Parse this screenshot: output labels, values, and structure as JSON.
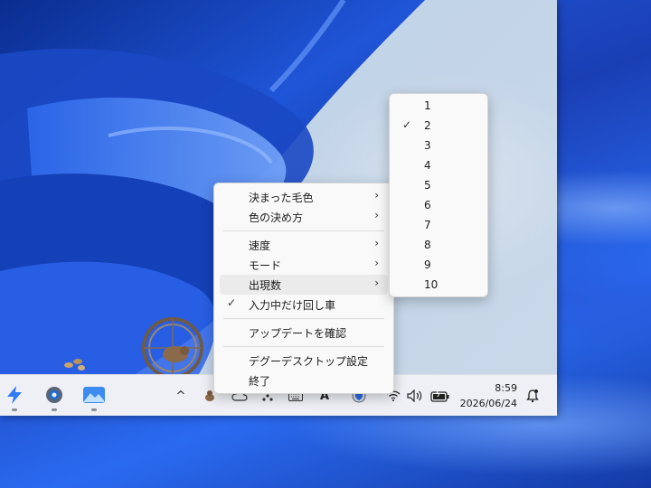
{
  "context_menu": {
    "items": [
      {
        "label": "決まった毛色",
        "submenu": true
      },
      {
        "label": "色の決め方",
        "submenu": true
      },
      {
        "label": "速度",
        "submenu": true
      },
      {
        "label": "モード",
        "submenu": true
      },
      {
        "label": "出現数",
        "submenu": true,
        "highlighted": true
      },
      {
        "label": "入力中だけ回し車",
        "checked": true
      },
      {
        "label": "アップデートを確認"
      },
      {
        "label": "デグーデスクトップ設定"
      },
      {
        "label": "終了"
      }
    ]
  },
  "submenu": {
    "items": [
      "1",
      "2",
      "3",
      "4",
      "5",
      "6",
      "7",
      "8",
      "9",
      "10"
    ],
    "selected": "2"
  },
  "taskbar": {
    "apps": [
      "power-automate-icon",
      "settings-gear-icon",
      "photos-icon"
    ],
    "tray": [
      "chevron-up-icon",
      "degu-tray-icon",
      "cloud-icon",
      "dots-grid-icon",
      "keyboard-icon",
      "ime-a-icon",
      "security-shield-icon",
      "wifi-icon",
      "volume-icon",
      "battery-icon"
    ],
    "time": "8:59",
    "date": "2026/06/24",
    "notification_icon": "bell-icon"
  },
  "glyphs": {
    "check": "✓",
    "chevron": "›",
    "chevron_up": "^",
    "ime": "A"
  },
  "colors": {
    "accent": "#1a5fd8",
    "menu_bg": "#f9f9f9",
    "menu_hover": "#ebebeb"
  }
}
